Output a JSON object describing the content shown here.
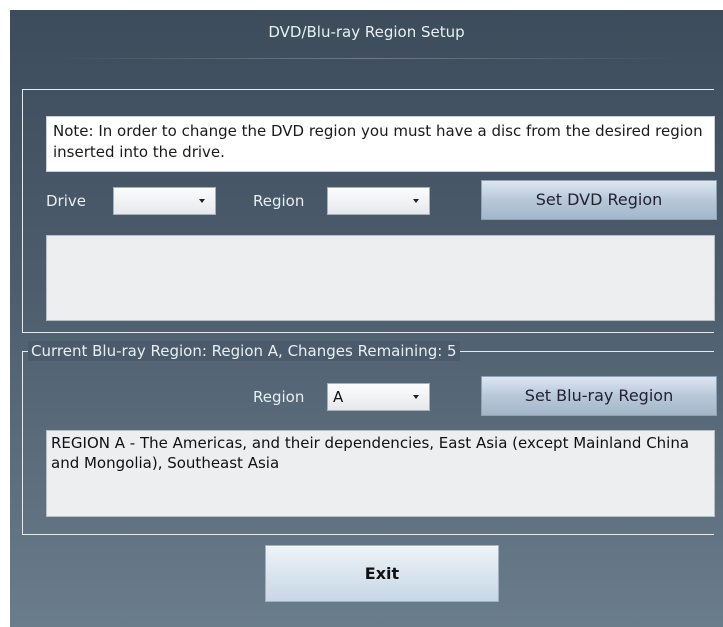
{
  "window": {
    "title": "DVD/Blu-ray Region Setup"
  },
  "dvd": {
    "note": "Note: In order to change the DVD region you must have a disc from the desired region inserted into the drive.",
    "drive_label": "Drive",
    "drive_value": "",
    "region_label": "Region",
    "region_value": "",
    "set_button": "Set DVD Region",
    "info_text": ""
  },
  "bluray": {
    "legend": "Current Blu-ray Region: Region A, Changes Remaining: 5",
    "region_label": "Region",
    "region_value": "A",
    "set_button": "Set Blu-ray Region",
    "info_text": "REGION A - The Americas, and their dependencies, East Asia (except Mainland China and Mongolia), Southeast Asia"
  },
  "footer": {
    "exit_label": "Exit"
  }
}
